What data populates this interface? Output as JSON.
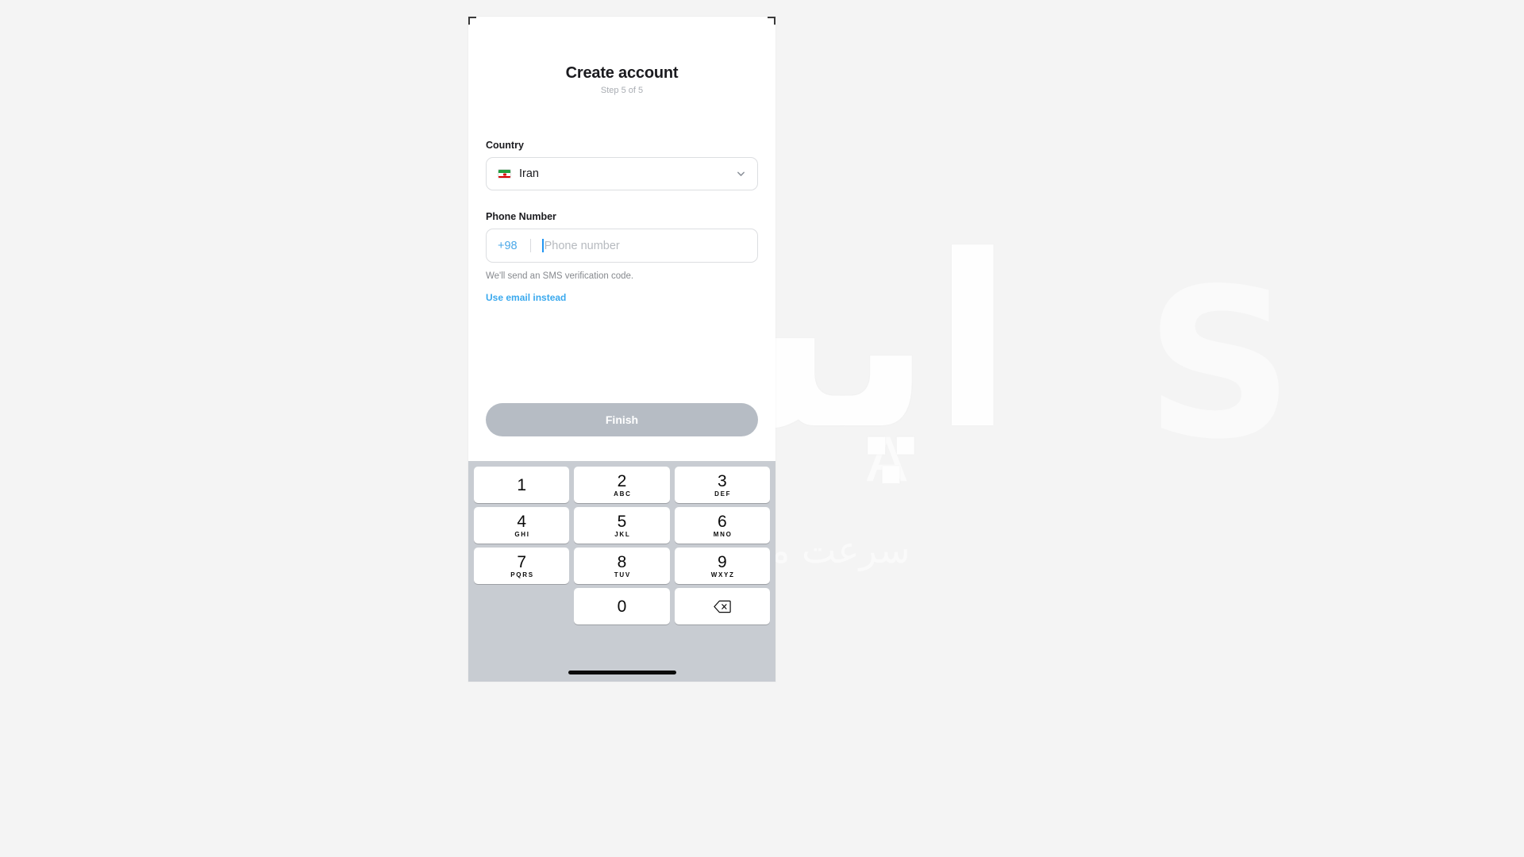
{
  "watermark": {
    "line_big": "اپسا",
    "line_mid": "A Z A",
    "line_small": "سرعت میزبانی وب",
    "logo": "S"
  },
  "screen": {
    "title": "Create account",
    "step_text": "Step 5 of 5",
    "country": {
      "label": "Country",
      "selected_value": "Iran",
      "flag_icon": "iran-flag-icon",
      "chevron_icon": "chevron-down-icon"
    },
    "phone": {
      "label": "Phone Number",
      "dial_code": "+98",
      "placeholder": "Phone number",
      "value": "",
      "hint": "We'll send an SMS verification code.",
      "alt_link": "Use email instead"
    },
    "submit_label": "Finish",
    "colors": {
      "accent_blue": "#3aa9ee",
      "dial_code_blue": "#4aa8e8",
      "caret_blue": "#2196f3",
      "button_disabled": "#b6bcc4",
      "keypad_bg": "#c8ccd2",
      "text_primary": "#1b1b1f",
      "text_muted": "#86898e",
      "placeholder": "#b6babf"
    }
  },
  "keypad": {
    "rows": [
      [
        {
          "num": "1",
          "letters": ""
        },
        {
          "num": "2",
          "letters": "ABC"
        },
        {
          "num": "3",
          "letters": "DEF"
        }
      ],
      [
        {
          "num": "4",
          "letters": "GHI"
        },
        {
          "num": "5",
          "letters": "JKL"
        },
        {
          "num": "6",
          "letters": "MNO"
        }
      ],
      [
        {
          "num": "7",
          "letters": "PQRS"
        },
        {
          "num": "8",
          "letters": "TUV"
        },
        {
          "num": "9",
          "letters": "WXYZ"
        }
      ],
      [
        {
          "num": "",
          "letters": "",
          "blank": true
        },
        {
          "num": "0",
          "letters": ""
        },
        {
          "num": "",
          "letters": "",
          "backspace": true,
          "icon": "backspace-icon"
        }
      ]
    ]
  }
}
